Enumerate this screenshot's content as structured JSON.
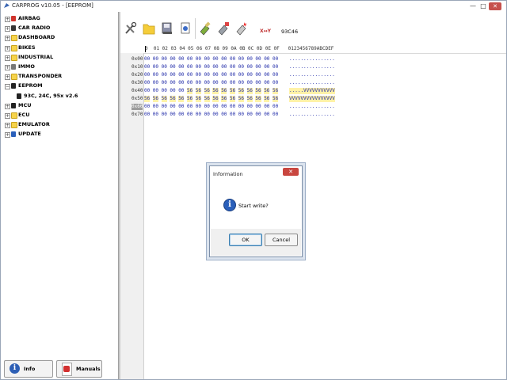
{
  "window": {
    "title": "CARPROG  v10.05 - [EEPROM]",
    "minimize": "—",
    "maximize": "□",
    "close": "✕"
  },
  "tree": {
    "items": [
      {
        "label": "AIRBAG",
        "icon": "airbag-icon",
        "expander": "+"
      },
      {
        "label": "CAR RADIO",
        "icon": "radio-icon",
        "expander": "+"
      },
      {
        "label": "DASHBOARD",
        "icon": "folder-icon",
        "expander": "+"
      },
      {
        "label": "BIKES",
        "icon": "folder-icon",
        "expander": "+"
      },
      {
        "label": "INDUSTRIAL",
        "icon": "folder-icon",
        "expander": "+"
      },
      {
        "label": "IMMO",
        "icon": "key-icon",
        "expander": "+"
      },
      {
        "label": "TRANSPONDER",
        "icon": "folder-icon",
        "expander": "+"
      },
      {
        "label": "EEPROM",
        "icon": "chip-icon",
        "expander": "−"
      },
      {
        "label": "93C, 24C, 95x v2.6",
        "icon": "chip-icon",
        "expander": ""
      },
      {
        "label": "MCU",
        "icon": "chip-icon",
        "expander": "+"
      },
      {
        "label": "ECU",
        "icon": "folder-icon",
        "expander": "+"
      },
      {
        "label": "EMULATOR",
        "icon": "folder-icon",
        "expander": "+"
      },
      {
        "label": "UPDATE",
        "icon": "update-icon",
        "expander": "+"
      }
    ]
  },
  "bottom_panel": {
    "info_label": "Info",
    "manuals_label": "Manuals"
  },
  "toolbar": {
    "tools": [
      "tools-icon",
      "open-folder-icon",
      "save-icon",
      "read-icon",
      "write-icon",
      "verify-icon",
      "erase-icon"
    ],
    "xy_label": "X↔Y",
    "device_label": "93C46"
  },
  "hex": {
    "header": "0  01 02 03 04 05 06 07 08 09 0A 0B 0C 0D 0E 0F   0123456789ABCDEF",
    "rows": [
      {
        "addr": "0x00",
        "bytes": [
          "00",
          "00",
          "00",
          "00",
          "00",
          "00",
          "00",
          "00",
          "00",
          "00",
          "00",
          "00",
          "00",
          "00",
          "00",
          "00"
        ],
        "ascii": "................",
        "selected": false
      },
      {
        "addr": "0x10",
        "bytes": [
          "00",
          "00",
          "00",
          "00",
          "00",
          "00",
          "00",
          "00",
          "00",
          "00",
          "00",
          "00",
          "00",
          "00",
          "00",
          "00"
        ],
        "ascii": "................",
        "selected": false
      },
      {
        "addr": "0x20",
        "bytes": [
          "00",
          "00",
          "00",
          "00",
          "00",
          "00",
          "00",
          "00",
          "00",
          "00",
          "00",
          "00",
          "00",
          "00",
          "00",
          "00"
        ],
        "ascii": "................",
        "selected": false
      },
      {
        "addr": "0x30",
        "bytes": [
          "00",
          "00",
          "00",
          "00",
          "00",
          "00",
          "00",
          "00",
          "00",
          "00",
          "00",
          "00",
          "00",
          "00",
          "00",
          "00"
        ],
        "ascii": "................",
        "selected": false
      },
      {
        "addr": "0x40",
        "bytes": [
          "00",
          "00",
          "00",
          "00",
          "00",
          "56",
          "56",
          "56",
          "56",
          "56",
          "56",
          "56",
          "56",
          "56",
          "56",
          "56"
        ],
        "ascii": ".....VVVVVVVVVVV",
        "selected": false,
        "hl_from": 5
      },
      {
        "addr": "0x50",
        "bytes": [
          "56",
          "56",
          "56",
          "56",
          "56",
          "56",
          "56",
          "56",
          "56",
          "56",
          "56",
          "56",
          "56",
          "56",
          "56",
          "56"
        ],
        "ascii": "VVVVVVVVVVVVVVVV",
        "selected": false,
        "hl_from": 0
      },
      {
        "addr": "0x60",
        "bytes": [
          "00",
          "00",
          "00",
          "00",
          "00",
          "00",
          "00",
          "00",
          "00",
          "00",
          "00",
          "00",
          "00",
          "00",
          "00",
          "00"
        ],
        "ascii": "................",
        "selected": true
      },
      {
        "addr": "0x70",
        "bytes": [
          "00",
          "00",
          "00",
          "00",
          "00",
          "00",
          "00",
          "00",
          "00",
          "00",
          "00",
          "00",
          "00",
          "00",
          "00",
          "00"
        ],
        "ascii": "................",
        "selected": false
      }
    ]
  },
  "dialog": {
    "title": "Information",
    "close": "✕",
    "message": "Start write?",
    "ok_label": "OK",
    "cancel_label": "Cancel",
    "icon": "info-icon"
  }
}
